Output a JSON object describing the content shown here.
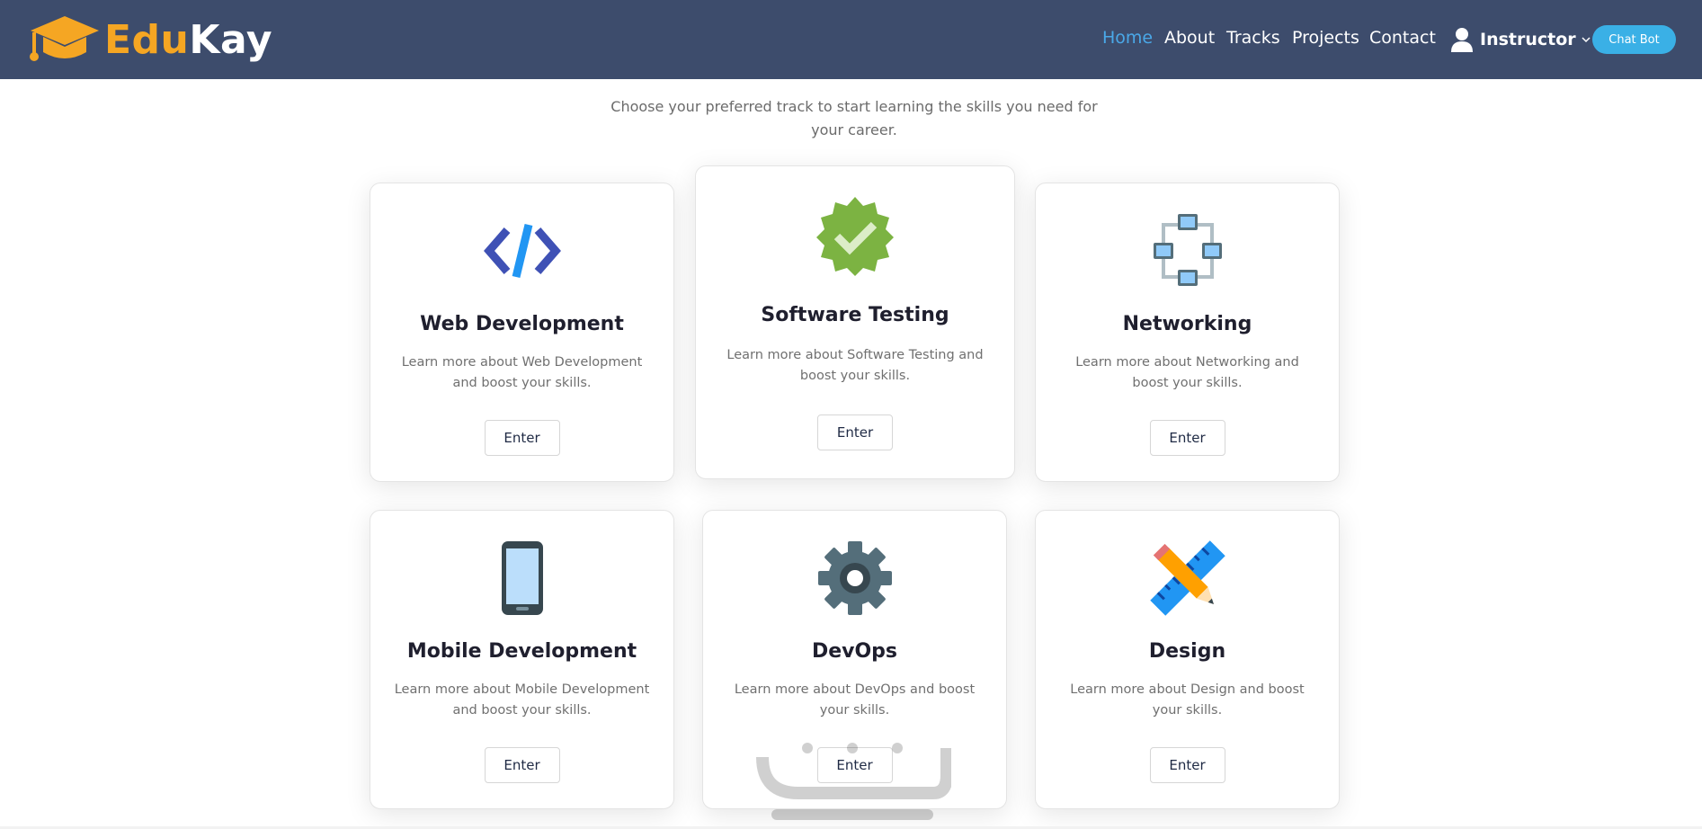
{
  "brand": {
    "part1": "Edu",
    "part2": "Kay"
  },
  "nav": {
    "items": [
      "Home",
      "About",
      "Tracks",
      "Projects",
      "Contact"
    ],
    "active": "Home",
    "user_label": "Instructor",
    "chat_button": "Chat Bot"
  },
  "intro": "Choose your preferred track to start learning the skills you need for your career.",
  "tracks": [
    {
      "title": "Web Development",
      "desc": "Learn more about Web Development and boost your skills.",
      "button": "Enter",
      "icon": "code-icon"
    },
    {
      "title": "Software Testing",
      "desc": "Learn more about Software Testing and boost your skills.",
      "button": "Enter",
      "icon": "verified-badge-icon"
    },
    {
      "title": "Networking",
      "desc": "Learn more about Networking and boost your skills.",
      "button": "Enter",
      "icon": "network-icon"
    },
    {
      "title": "Mobile Development",
      "desc": "Learn more about Mobile Development and boost your skills.",
      "button": "Enter",
      "icon": "smartphone-icon"
    },
    {
      "title": "DevOps",
      "desc": "Learn more about DevOps and boost your skills.",
      "button": "Enter",
      "icon": "gear-icon"
    },
    {
      "title": "Design",
      "desc": "Learn more about Design and boost your skills.",
      "button": "Enter",
      "icon": "pencil-ruler-icon"
    }
  ],
  "colors": {
    "header_bg": "#3d4c6c",
    "brand_accent": "#f5a623",
    "nav_active": "#4aa8e8",
    "chat_button_bg": "#3ab0e6"
  }
}
